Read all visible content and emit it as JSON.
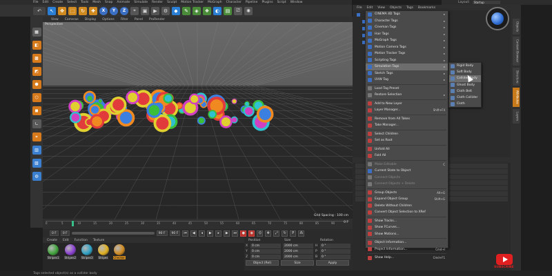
{
  "menubar": [
    "File",
    "Edit",
    "Create",
    "Select",
    "Tools",
    "Mesh",
    "Snap",
    "Animate",
    "Simulate",
    "Render",
    "Sculpt",
    "Motion Tracker",
    "MoGraph",
    "Character",
    "Pipeline",
    "Plugins",
    "Script",
    "Window"
  ],
  "layout": {
    "label": "Layout:",
    "value": "Startup"
  },
  "viewport": {
    "menu": [
      "View",
      "Cameras",
      "Display",
      "Options",
      "Filter",
      "Panel",
      "ProRender"
    ],
    "label": "Perspective",
    "grid_spacing": "Grid Spacing : 100 cm"
  },
  "timeline": {
    "ticks": [
      "0",
      "5",
      "10",
      "15",
      "20",
      "25",
      "30",
      "35",
      "40",
      "45",
      "50",
      "55",
      "60",
      "65",
      "70",
      "75",
      "80",
      "85",
      "90"
    ],
    "end": "0 F"
  },
  "transport": {
    "start": "0 F",
    "mid": "0 F",
    "end": "90 F",
    "end2": "90 F"
  },
  "materials": {
    "menu": [
      "Create",
      "Edit",
      "Function",
      "Texture"
    ],
    "items": [
      {
        "name": "Stripes1",
        "color": "#3fa33a"
      },
      {
        "name": "Stripes2",
        "color": "#8a3fd1"
      },
      {
        "name": "Stripes3",
        "color": "#2ca0c4"
      },
      {
        "name": "Stripes",
        "color": "#e0b020"
      },
      {
        "name": "Checker",
        "color": "#d08a20"
      }
    ]
  },
  "coordinates": {
    "headers": [
      "Position",
      "Size",
      "Rotation"
    ],
    "rows": [
      {
        "axis": "X",
        "pos": "0 cm",
        "size": "2000 cm",
        "rot_axis": "H",
        "rot": "0 °"
      },
      {
        "axis": "Y",
        "pos": "0 cm",
        "size": "2000 cm",
        "rot_axis": "P",
        "rot": "0 °"
      },
      {
        "axis": "Z",
        "pos": "0 cm",
        "size": "2000 cm",
        "rot_axis": "B",
        "rot": "0 °"
      }
    ],
    "mode": "Object (Rel)",
    "size_mode": "Size",
    "apply": "Apply"
  },
  "status": "Tags selected object(s) as a collider body",
  "object_manager": {
    "menu": [
      "File",
      "Edit",
      "View",
      "Objects",
      "Tags",
      "Bookmarks"
    ]
  },
  "right_tabs": [
    "Objects",
    "Content Browser",
    "Structure",
    "Attributes",
    "Layers"
  ],
  "context_menu": {
    "items": [
      {
        "label": "CINEMA 4D Tags",
        "arrow": "▸",
        "icon": "#3a6fc4"
      },
      {
        "label": "Character Tags",
        "arrow": "▸",
        "icon": "#3a6fc4"
      },
      {
        "label": "Cineman Tags",
        "arrow": "▸",
        "icon": "#3a6fc4"
      },
      {
        "label": "Hair Tags",
        "arrow": "▸",
        "icon": "#3a6fc4"
      },
      {
        "label": "MoGraph Tags",
        "arrow": "▸",
        "icon": "#3a6fc4"
      },
      {
        "label": "Motion Camera Tags",
        "arrow": "▸",
        "icon": "#3a6fc4"
      },
      {
        "label": "Motion Tracker Tags",
        "arrow": "▸",
        "icon": "#3a6fc4"
      },
      {
        "label": "Scripting Tags",
        "arrow": "▸",
        "icon": "#3a6fc4"
      },
      {
        "label": "Simulation Tags",
        "arrow": "▸",
        "icon": "#3a6fc4",
        "highlight": true
      },
      {
        "label": "Sketch Tags",
        "arrow": "▸",
        "icon": "#3a6fc4"
      },
      {
        "label": "UVW Tag",
        "arrow": "▸",
        "icon": "#3a6fc4"
      },
      {
        "sep": true
      },
      {
        "label": "Load Tag Preset",
        "icon": "#777"
      },
      {
        "label": "Restore Selection",
        "arrow": "▸",
        "icon": "#777"
      },
      {
        "sep": true
      },
      {
        "label": "Add to New Layer",
        "icon": "#c04040"
      },
      {
        "label": "Layer Manager...",
        "shortcut": "Shift+F4",
        "icon": "#c04040"
      },
      {
        "sep": true
      },
      {
        "label": "Remove from All Takes",
        "icon": "#c04040"
      },
      {
        "label": "Take Manager...",
        "icon": "#c04040"
      },
      {
        "sep": true
      },
      {
        "label": "Select Children",
        "icon": "#c04040"
      },
      {
        "label": "Set as Root",
        "icon": "#c04040"
      },
      {
        "sep": true
      },
      {
        "label": "Unfold All",
        "icon": "#c04040"
      },
      {
        "label": "Fold All",
        "icon": "#c04040"
      },
      {
        "sep": true
      },
      {
        "label": "Make Editable",
        "shortcut": "C",
        "icon": "#777",
        "disabled": true
      },
      {
        "label": "Current State to Object",
        "icon": "#3a6fc4"
      },
      {
        "label": "Connect Objects",
        "icon": "#777",
        "disabled": true
      },
      {
        "label": "Connect Objects + Delete",
        "icon": "#777",
        "disabled": true
      },
      {
        "sep": true
      },
      {
        "label": "Group Objects",
        "shortcut": "Alt+G",
        "icon": "#c04040"
      },
      {
        "label": "Expand Object Group",
        "shortcut": "Shift+G",
        "icon": "#c04040"
      },
      {
        "label": "Delete Without Children",
        "icon": "#c04040"
      },
      {
        "label": "Convert Object Selection to XRef",
        "icon": "#c04040"
      },
      {
        "sep": true
      },
      {
        "label": "Show Tracks...",
        "icon": "#c04040"
      },
      {
        "label": "Show FCurves...",
        "icon": "#c04040"
      },
      {
        "label": "Show Motions...",
        "icon": "#c04040"
      },
      {
        "sep": true
      },
      {
        "label": "Object Information...",
        "icon": "#c04040"
      },
      {
        "label": "Project Information...",
        "shortcut": "Cmd+I",
        "icon": "#c04040"
      },
      {
        "sep": true
      },
      {
        "label": "Show Help...",
        "shortcut": "Cmd+F1",
        "icon": "#c04040"
      }
    ]
  },
  "submenu": {
    "items": [
      {
        "label": "Rigid Body"
      },
      {
        "label": "Soft Body"
      },
      {
        "label": "Collider Body",
        "highlight": true
      },
      {
        "label": "Ghost Body"
      },
      {
        "label": "Cloth Belt"
      },
      {
        "label": "Cloth Collider"
      },
      {
        "label": "Cloth"
      }
    ]
  },
  "subscribe": "SUBSCRIBE",
  "colors": {
    "accent": "#d08a20",
    "selection": "#2a7fd4",
    "menu_highlight": "#6d6d6d",
    "youtube": "#e02020"
  }
}
